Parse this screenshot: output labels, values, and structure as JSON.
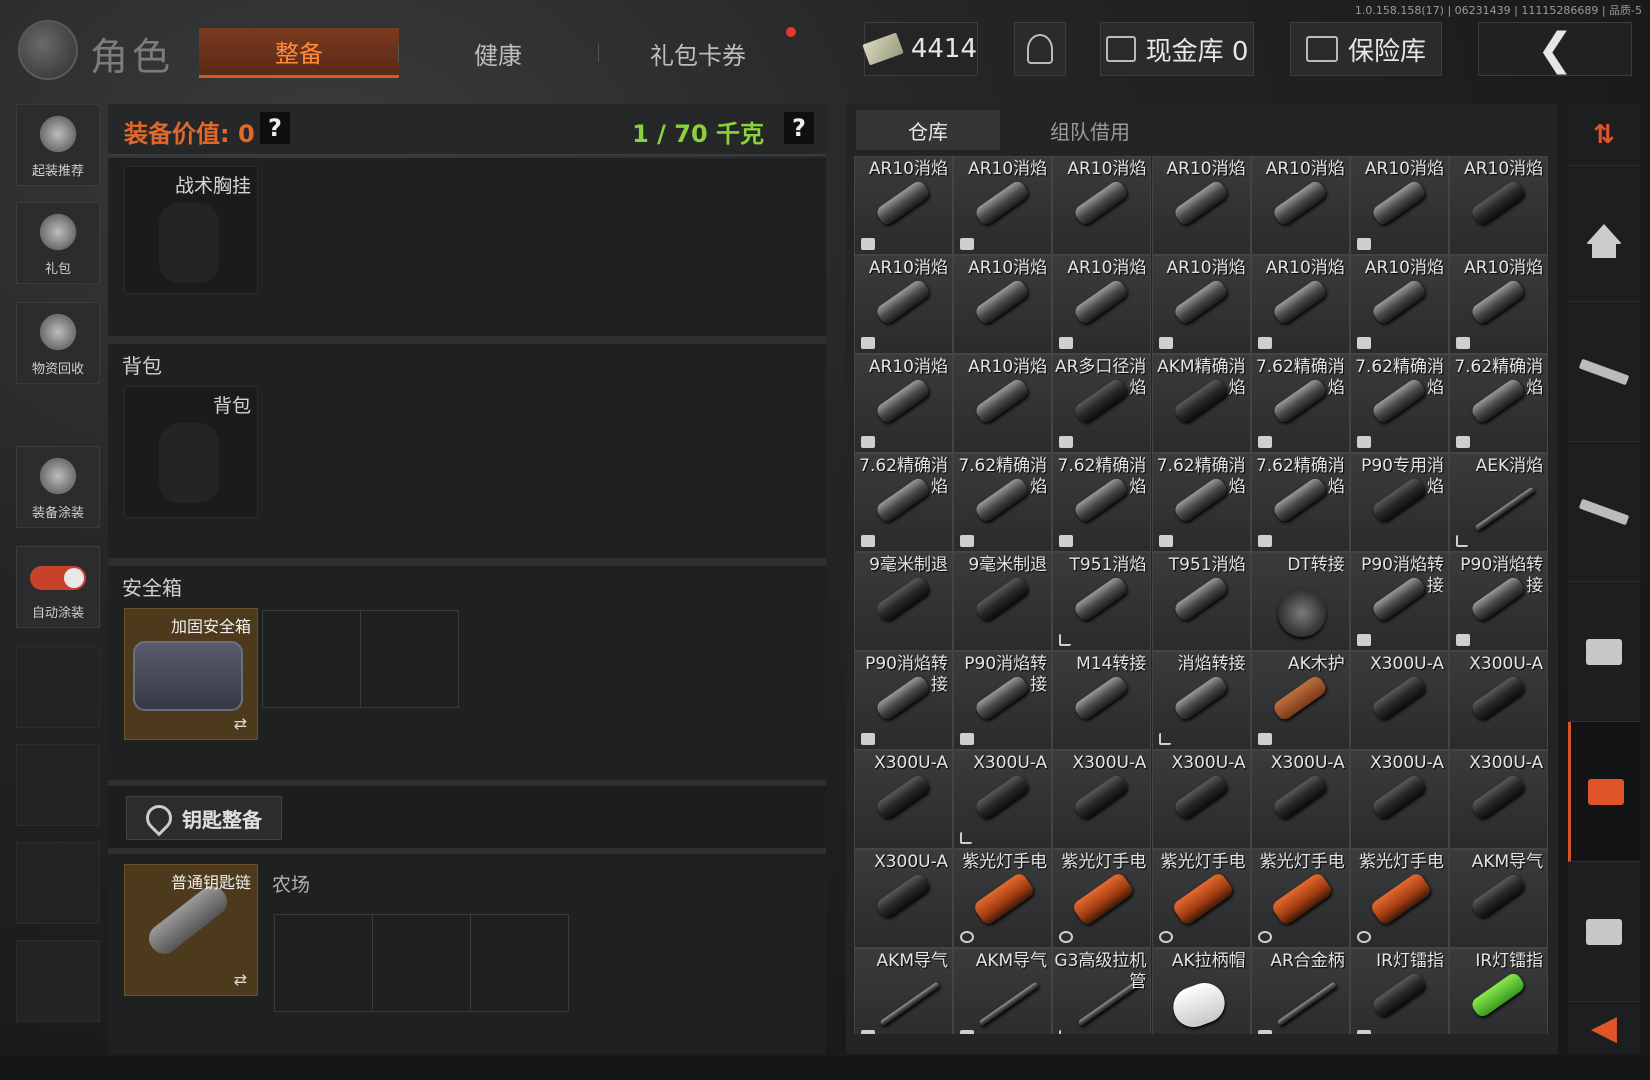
{
  "version": "1.0.158.158(17) | 06231439 | 11115286689 | 品质-5",
  "header": {
    "title": "角色",
    "tabs": [
      {
        "label": "整备",
        "active": true
      },
      {
        "label": "健康",
        "active": false
      },
      {
        "label": "礼包卡券",
        "active": false,
        "notification": true
      }
    ],
    "currency": "4414",
    "cash_vault": "现金库 0",
    "safe_label": "保险库",
    "back_icon": "back-chevron-icon"
  },
  "left_sidebar": [
    {
      "label": "起装推荐",
      "icon": "helmet-icon"
    },
    {
      "label": "礼包",
      "icon": "gift-icon"
    },
    {
      "label": "物资回收",
      "icon": "recycle-icon"
    },
    {
      "label": "装备涂装",
      "icon": "paint-icon"
    },
    {
      "label": "自动涂装",
      "icon": "toggle-icon",
      "toggle_on": true
    }
  ],
  "equipment": {
    "value_label": "装备价值: 0",
    "weight_label": "1 / 70 千克",
    "help": "?",
    "chest_rig": "战术胸挂",
    "backpack_section": "背包",
    "backpack_slot": "背包",
    "safe_section": "安全箱",
    "safe_slot": "加固安全箱",
    "key_button": "钥匙整备",
    "keychain_slot": "普通钥匙链",
    "farm_label": "农场"
  },
  "inventory": {
    "tabs": [
      {
        "label": "仓库",
        "active": true
      },
      {
        "label": "组队借用",
        "active": false
      }
    ],
    "items": [
      {
        "name": "AR10消焰",
        "art": "",
        "badge": "box"
      },
      {
        "name": "AR10消焰",
        "art": "",
        "badge": "box"
      },
      {
        "name": "AR10消焰",
        "art": "",
        "badge": ""
      },
      {
        "name": "AR10消焰",
        "art": "",
        "badge": ""
      },
      {
        "name": "AR10消焰",
        "art": "",
        "badge": ""
      },
      {
        "name": "AR10消焰",
        "art": "",
        "badge": "box"
      },
      {
        "name": "AR10消焰",
        "art": "dark",
        "badge": ""
      },
      {
        "name": "AR10消焰",
        "art": "",
        "badge": "box"
      },
      {
        "name": "AR10消焰",
        "art": "",
        "badge": ""
      },
      {
        "name": "AR10消焰",
        "art": "",
        "badge": "box"
      },
      {
        "name": "AR10消焰",
        "art": "",
        "badge": "box"
      },
      {
        "name": "AR10消焰",
        "art": "",
        "badge": "box"
      },
      {
        "name": "AR10消焰",
        "art": "",
        "badge": "box"
      },
      {
        "name": "AR10消焰",
        "art": "",
        "badge": "box"
      },
      {
        "name": "AR10消焰",
        "art": "",
        "badge": "box"
      },
      {
        "name": "AR10消焰",
        "art": "",
        "badge": ""
      },
      {
        "name": "AR多口径消焰",
        "art": "dark",
        "badge": "box"
      },
      {
        "name": "AKM精确消焰",
        "art": "dark",
        "badge": ""
      },
      {
        "name": "7.62精确消焰",
        "art": "",
        "badge": "box"
      },
      {
        "name": "7.62精确消焰",
        "art": "",
        "badge": "box"
      },
      {
        "name": "7.62精确消焰",
        "art": "",
        "badge": "box"
      },
      {
        "name": "7.62精确消焰",
        "art": "",
        "badge": "box"
      },
      {
        "name": "7.62精确消焰",
        "art": "",
        "badge": "box"
      },
      {
        "name": "7.62精确消焰",
        "art": "",
        "badge": "box"
      },
      {
        "name": "7.62精确消焰",
        "art": "",
        "badge": "box"
      },
      {
        "name": "7.62精确消焰",
        "art": "",
        "badge": "box"
      },
      {
        "name": "P90专用消焰",
        "art": "dark",
        "badge": ""
      },
      {
        "name": "AEK消焰",
        "art": "rod",
        "badge": "exit"
      },
      {
        "name": "9毫米制退",
        "art": "dark",
        "badge": ""
      },
      {
        "name": "9毫米制退",
        "art": "dark",
        "badge": ""
      },
      {
        "name": "T951消焰",
        "art": "",
        "badge": "exit"
      },
      {
        "name": "T951消焰",
        "art": "",
        "badge": ""
      },
      {
        "name": "DT转接",
        "art": "round",
        "badge": ""
      },
      {
        "name": "P90消焰转接",
        "art": "",
        "badge": "box"
      },
      {
        "name": "P90消焰转接",
        "art": "",
        "badge": "box"
      },
      {
        "name": "P90消焰转接",
        "art": "",
        "badge": "box"
      },
      {
        "name": "P90消焰转接",
        "art": "",
        "badge": "box"
      },
      {
        "name": "M14转接",
        "art": "",
        "badge": ""
      },
      {
        "name": "消焰转接",
        "art": "",
        "badge": "exit"
      },
      {
        "name": "AK木护",
        "art": "wood",
        "badge": "box"
      },
      {
        "name": "X300U-A",
        "art": "dark",
        "badge": ""
      },
      {
        "name": "X300U-A",
        "art": "dark",
        "badge": ""
      },
      {
        "name": "X300U-A",
        "art": "dark",
        "badge": ""
      },
      {
        "name": "X300U-A",
        "art": "dark",
        "badge": "exit"
      },
      {
        "name": "X300U-A",
        "art": "dark",
        "badge": ""
      },
      {
        "name": "X300U-A",
        "art": "dark",
        "badge": ""
      },
      {
        "name": "X300U-A",
        "art": "dark",
        "badge": ""
      },
      {
        "name": "X300U-A",
        "art": "dark",
        "badge": ""
      },
      {
        "name": "X300U-A",
        "art": "dark",
        "badge": ""
      },
      {
        "name": "X300U-A",
        "art": "dark",
        "badge": ""
      },
      {
        "name": "紫光灯手电",
        "art": "flash",
        "badge": "circle"
      },
      {
        "name": "紫光灯手电",
        "art": "flash",
        "badge": "circle"
      },
      {
        "name": "紫光灯手电",
        "art": "flash",
        "badge": "circle"
      },
      {
        "name": "紫光灯手电",
        "art": "flash",
        "badge": "circle"
      },
      {
        "name": "紫光灯手电",
        "art": "flash",
        "badge": "circle"
      },
      {
        "name": "AKM导气",
        "art": "dark",
        "badge": ""
      },
      {
        "name": "AKM导气",
        "art": "rod",
        "badge": "box"
      },
      {
        "name": "AKM导气",
        "art": "rod",
        "badge": "box"
      },
      {
        "name": "G3高级拉机管",
        "art": "rod",
        "badge": "exit"
      },
      {
        "name": "AK拉柄帽",
        "art": "white",
        "badge": ""
      },
      {
        "name": "AR合金柄",
        "art": "rod",
        "badge": "box"
      },
      {
        "name": "IR灯镭指",
        "art": "dark",
        "badge": "box"
      },
      {
        "name": "IR灯镭指",
        "art": "green",
        "badge": ""
      }
    ]
  },
  "right_sidebar": [
    {
      "icon": "sort-icon"
    },
    {
      "icon": "home-icon"
    },
    {
      "icon": "rifle-icon"
    },
    {
      "icon": "rifle-alt-icon"
    },
    {
      "icon": "storage-box-icon"
    },
    {
      "icon": "storage-box-active-icon",
      "active": true
    },
    {
      "icon": "storage-box-alt-icon"
    },
    {
      "icon": "collapse-arrow-icon"
    }
  ],
  "colors": {
    "accent": "#e0542a",
    "weight_green": "#8bd23a",
    "active_tab": "#5a2a18"
  }
}
